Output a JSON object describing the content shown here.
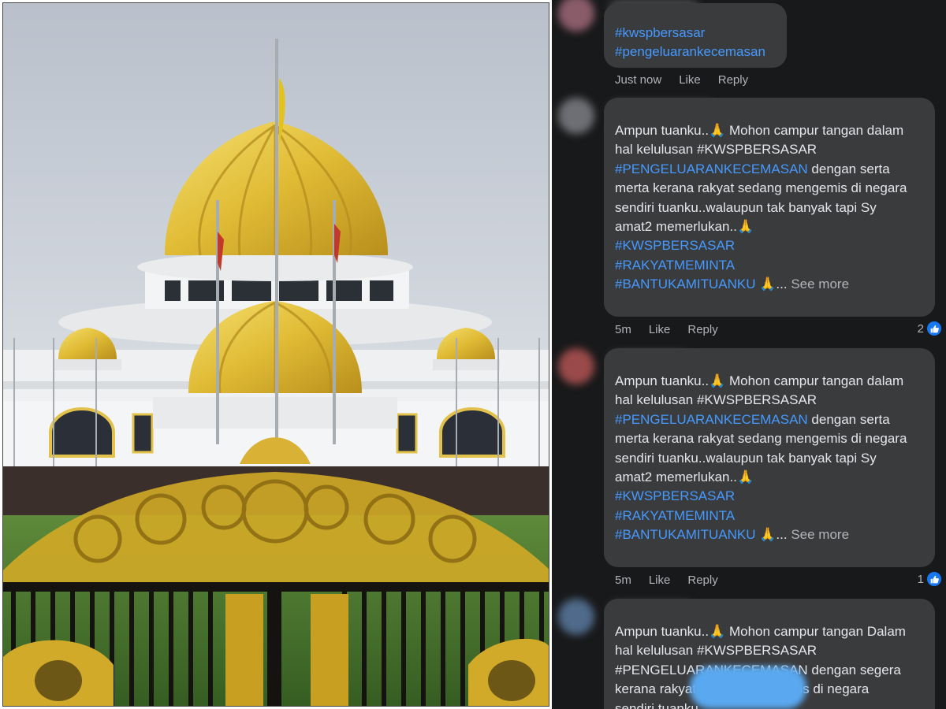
{
  "photo": {
    "subject": "palace-photo"
  },
  "comments": [
    {
      "lines": [
        [
          {
            "t": "#kwspbersasar",
            "k": "tag"
          }
        ],
        [
          {
            "t": "#pengeluarankecemasan",
            "k": "tag"
          }
        ]
      ],
      "actions": {
        "time": "Just now",
        "like": "Like",
        "reply": "Reply"
      },
      "reaction_count": ""
    },
    {
      "lines": [
        [
          {
            "t": "Ampun tuanku..",
            "k": "text"
          },
          {
            "t": "🙏",
            "k": "emoji"
          },
          {
            "t": " Mohon campur tangan dalam",
            "k": "text"
          }
        ],
        [
          {
            "t": "hal kelulusan  #KWSPBERSASAR",
            "k": "text"
          }
        ],
        [
          {
            "t": "#PENGELUARANKECEMASAN",
            "k": "tag"
          },
          {
            "t": " dengan serta",
            "k": "text"
          }
        ],
        [
          {
            "t": "merta kerana rakyat sedang mengemis di negara",
            "k": "text"
          }
        ],
        [
          {
            "t": "sendiri tuanku..walaupun tak banyak tapi Sy",
            "k": "text"
          }
        ],
        [
          {
            "t": "amat2 memerlukan..",
            "k": "text"
          },
          {
            "t": "🙏",
            "k": "emoji"
          }
        ],
        [
          {
            "t": " ",
            "k": "text"
          }
        ],
        [
          {
            "t": "#KWSPBERSASAR",
            "k": "tag"
          }
        ],
        [
          {
            "t": "#RAKYATMEMINTA",
            "k": "tag"
          }
        ],
        [
          {
            "t": "#BANTUKAMITUANKU",
            "k": "tag"
          },
          {
            "t": " 🙏",
            "k": "emoji"
          },
          {
            "t": "... ",
            "k": "text"
          },
          {
            "t": "See more",
            "k": "more"
          }
        ]
      ],
      "actions": {
        "time": "5m",
        "like": "Like",
        "reply": "Reply"
      },
      "reaction_count": "2"
    },
    {
      "lines": [
        [
          {
            "t": "Ampun tuanku..",
            "k": "text"
          },
          {
            "t": "🙏",
            "k": "emoji"
          },
          {
            "t": " Mohon campur tangan dalam",
            "k": "text"
          }
        ],
        [
          {
            "t": "hal kelulusan  #KWSPBERSASAR",
            "k": "text"
          }
        ],
        [
          {
            "t": "#PENGELUARANKECEMASAN",
            "k": "tag"
          },
          {
            "t": " dengan serta",
            "k": "text"
          }
        ],
        [
          {
            "t": "merta kerana rakyat sedang mengemis di negara",
            "k": "text"
          }
        ],
        [
          {
            "t": "sendiri tuanku..walaupun tak banyak tapi Sy",
            "k": "text"
          }
        ],
        [
          {
            "t": "amat2 memerlukan..",
            "k": "text"
          },
          {
            "t": "🙏",
            "k": "emoji"
          }
        ],
        [
          {
            "t": " ",
            "k": "text"
          }
        ],
        [
          {
            "t": "#KWSPBERSASAR",
            "k": "tag"
          }
        ],
        [
          {
            "t": "#RAKYATMEMINTA",
            "k": "tag"
          }
        ],
        [
          {
            "t": "#BANTUKAMITUANKU",
            "k": "tag"
          },
          {
            "t": " 🙏",
            "k": "emoji"
          },
          {
            "t": "... ",
            "k": "text"
          },
          {
            "t": "See more",
            "k": "more"
          }
        ]
      ],
      "actions": {
        "time": "5m",
        "like": "Like",
        "reply": "Reply"
      },
      "reaction_count": "1"
    },
    {
      "lines": [
        [
          {
            "t": "Ampun tuanku..",
            "k": "text"
          },
          {
            "t": "🙏",
            "k": "emoji"
          },
          {
            "t": " Mohon campur tangan Dalam",
            "k": "text"
          }
        ],
        [
          {
            "t": "hal kelulusan #KWSPBERSASAR",
            "k": "text"
          }
        ],
        [
          {
            "t": "#PENGELUARANKECEMASAN dengan segera",
            "k": "text"
          }
        ],
        [
          {
            "t": "kerana rakyat sedang mengemis di negara",
            "k": "text"
          }
        ],
        [
          {
            "t": "sendiri tuanku",
            "k": "text"
          }
        ]
      ],
      "actions": null,
      "reaction_count": ""
    }
  ],
  "colors": {
    "background": "#18191a",
    "bubble": "#3a3b3c",
    "text": "#e4e6eb",
    "secondary": "#b0b3b8",
    "hashtag": "#4599ff",
    "like_blue": "#1877f2",
    "dome_gold": "#e4c44a"
  },
  "icons": [
    "folded-hands-emoji",
    "like-thumb-icon"
  ]
}
